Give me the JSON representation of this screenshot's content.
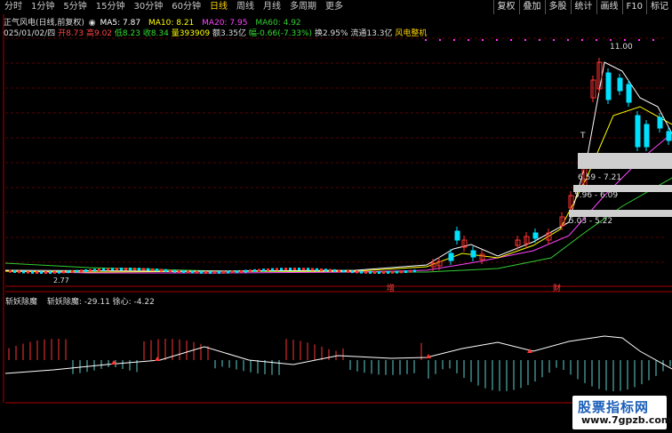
{
  "toolbar": {
    "periods": [
      "分时",
      "1分钟",
      "5分钟",
      "15分钟",
      "30分钟",
      "60分钟",
      "日线",
      "周线",
      "月线",
      "多周期",
      "更多"
    ],
    "active_period": "日线",
    "right_buttons": [
      "复权",
      "叠加",
      "多股",
      "统计",
      "画线",
      "F10",
      "标记"
    ]
  },
  "header1": {
    "title": "正气风电(日线,前复权)",
    "ma5": "MA5: 7.87",
    "ma10": "MA10: 8.21",
    "ma20": "MA20: 7.95",
    "ma60": "MA60: 4.92"
  },
  "header2": {
    "date": "025/01/02/四",
    "open": "开8.73",
    "high": "高9.02",
    "low": "低8.23",
    "close": "收8.34",
    "volume": "量393909",
    "amount": "额3.35亿",
    "change": "幅-0.66(-7.33%)",
    "turnover": "换2.95%",
    "float": "流通13.3亿",
    "concept": "风电整机"
  },
  "chart_labels": {
    "high_price": "11.00",
    "low_price": "2.77",
    "t_mark": "T",
    "range1": "6.59 - 7.21",
    "range2": "5.96 - 6.09",
    "range3": "5.03 - 5.22",
    "marker_zeng": "增",
    "marker_cai": "财"
  },
  "indicator": {
    "name": "斩妖除魔",
    "values": "斩妖除魔: -29.11  徐心: -4.22"
  },
  "watermark": {
    "line1": "股票指标网",
    "line2": "www.7gpzb.com"
  },
  "colors": {
    "up": "#ff3333",
    "down": "#00e0ff",
    "ma5": "#ffffff",
    "ma10": "#ffff00",
    "ma20": "#ff44ff",
    "ma60": "#33cc33"
  }
}
